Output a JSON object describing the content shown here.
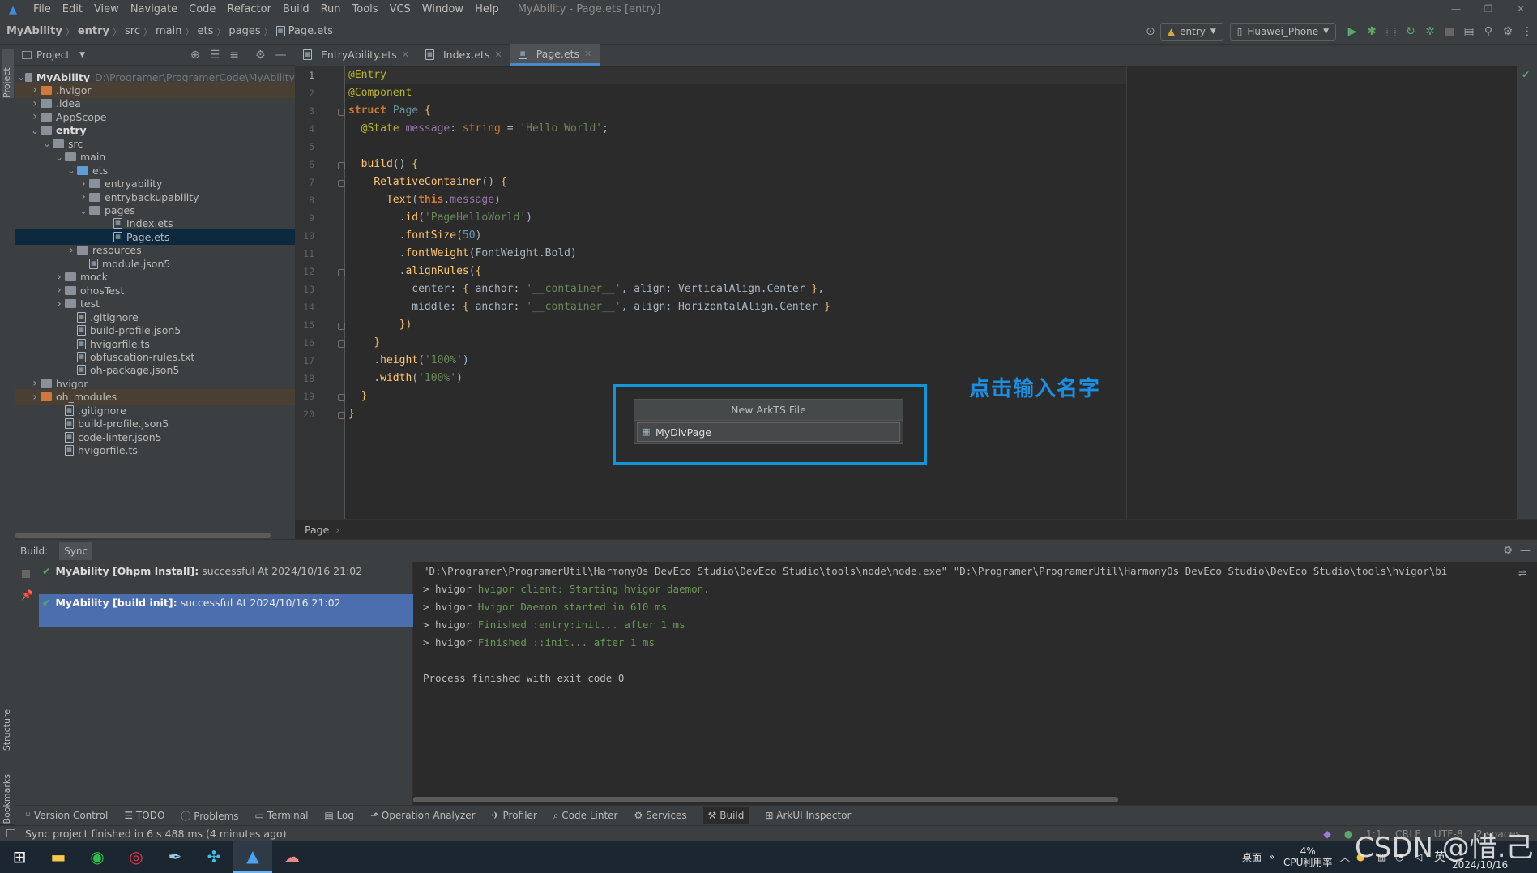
{
  "window": {
    "title": "MyAbility - Page.ets [entry]"
  },
  "menu": [
    "File",
    "Edit",
    "View",
    "Navigate",
    "Code",
    "Refactor",
    "Build",
    "Run",
    "Tools",
    "VCS",
    "Window",
    "Help"
  ],
  "breadcrumb": [
    "MyAbility",
    "entry",
    "src",
    "main",
    "ets",
    "pages",
    "Page.ets"
  ],
  "toolbar": {
    "module_selector": "entry",
    "device_selector": "Huawei_Phone"
  },
  "project_panel": {
    "title": "Project",
    "tree": [
      {
        "label": "MyAbility",
        "path": "D:\\Programer\\ProgramerCode\\MyAbility",
        "depth": 0,
        "kind": "module",
        "open": true
      },
      {
        "label": ".hvigor",
        "depth": 1,
        "kind": "folder-orange",
        "open": false,
        "excluded": true
      },
      {
        "label": ".idea",
        "depth": 1,
        "kind": "folder",
        "open": false
      },
      {
        "label": "AppScope",
        "depth": 1,
        "kind": "folder",
        "open": false
      },
      {
        "label": "entry",
        "depth": 1,
        "kind": "module",
        "open": true
      },
      {
        "label": "src",
        "depth": 2,
        "kind": "folder",
        "open": true
      },
      {
        "label": "main",
        "depth": 3,
        "kind": "folder",
        "open": true
      },
      {
        "label": "ets",
        "depth": 4,
        "kind": "folder-blue",
        "open": true
      },
      {
        "label": "entryability",
        "depth": 5,
        "kind": "folder",
        "open": false
      },
      {
        "label": "entrybackupability",
        "depth": 5,
        "kind": "folder",
        "open": false
      },
      {
        "label": "pages",
        "depth": 5,
        "kind": "folder",
        "open": true
      },
      {
        "label": "Index.ets",
        "depth": 7,
        "kind": "file"
      },
      {
        "label": "Page.ets",
        "depth": 7,
        "kind": "file",
        "selected": true
      },
      {
        "label": "resources",
        "depth": 4,
        "kind": "folder",
        "open": false
      },
      {
        "label": "module.json5",
        "depth": 5,
        "kind": "file"
      },
      {
        "label": "mock",
        "depth": 3,
        "kind": "folder",
        "open": false
      },
      {
        "label": "ohosTest",
        "depth": 3,
        "kind": "folder",
        "open": false
      },
      {
        "label": "test",
        "depth": 3,
        "kind": "folder",
        "open": false
      },
      {
        "label": ".gitignore",
        "depth": 4,
        "kind": "file"
      },
      {
        "label": "build-profile.json5",
        "depth": 4,
        "kind": "file"
      },
      {
        "label": "hvigorfile.ts",
        "depth": 4,
        "kind": "file"
      },
      {
        "label": "obfuscation-rules.txt",
        "depth": 4,
        "kind": "file"
      },
      {
        "label": "oh-package.json5",
        "depth": 4,
        "kind": "file"
      },
      {
        "label": "hvigor",
        "depth": 1,
        "kind": "folder",
        "open": false
      },
      {
        "label": "oh_modules",
        "depth": 1,
        "kind": "folder-orange",
        "open": false,
        "excluded": true
      },
      {
        "label": ".gitignore",
        "depth": 3,
        "kind": "file"
      },
      {
        "label": "build-profile.json5",
        "depth": 3,
        "kind": "file"
      },
      {
        "label": "code-linter.json5",
        "depth": 3,
        "kind": "file"
      },
      {
        "label": "hvigorfile.ts",
        "depth": 3,
        "kind": "file"
      }
    ]
  },
  "editor": {
    "tabs": [
      {
        "label": "EntryAbility.ets",
        "active": false
      },
      {
        "label": "Index.ets",
        "active": false
      },
      {
        "label": "Page.ets",
        "active": true
      }
    ],
    "line_numbers": [
      "1",
      "2",
      "3",
      "4",
      "5",
      "6",
      "7",
      "8",
      "9",
      "10",
      "11",
      "12",
      "13",
      "14",
      "15",
      "16",
      "17",
      "18",
      "19",
      "20"
    ],
    "breadcrumb": "Page"
  },
  "dialog": {
    "title": "New ArkTS File",
    "input_value": "MyDivPage"
  },
  "annotation": "点击输入名字",
  "build_panel": {
    "label": "Build:",
    "tab": "Sync",
    "entries": [
      {
        "title": "MyAbility [Ohpm Install]:",
        "status": "successful At 2024/10/16 21:02"
      },
      {
        "title": "MyAbility [build init]:",
        "status": "successful At 2024/10/16 21:02"
      }
    ],
    "console": {
      "cmd": "\"D:\\Programer\\ProgramerUtil\\HarmonyOs DevEco Studio\\DevEco Studio\\tools\\node\\node.exe\" \"D:\\Programer\\ProgramerUtil\\HarmonyOs DevEco Studio\\DevEco Studio\\tools\\hvigor\\bi",
      "lines": [
        {
          "prefix": "> hvigor ",
          "text": "hvigor client: Starting hvigor daemon."
        },
        {
          "prefix": "> hvigor ",
          "text": "Hvigor Daemon started in 610 ms"
        },
        {
          "prefix": "> hvigor ",
          "text": "Finished :entry:init... after 1 ms"
        },
        {
          "prefix": "> hvigor ",
          "text": "Finished ::init... after 1 ms"
        }
      ],
      "exit": "Process finished with exit code 0"
    }
  },
  "tool_windows": [
    "Version Control",
    "TODO",
    "Problems",
    "Terminal",
    "Log",
    "Operation Analyzer",
    "Profiler",
    "Code Linter",
    "Services",
    "Build",
    "ArkUI Inspector"
  ],
  "status": {
    "message": "Sync project finished in 6 s 488 ms (4 minutes ago)",
    "position": "1:1",
    "line_sep": "CRLF",
    "encoding": "UTF-8",
    "indent": "2 spaces"
  },
  "side_labels": {
    "project": "Project",
    "structure": "Structure",
    "bookmarks": "Bookmarks"
  },
  "taskbar": {
    "desktop": "桌面",
    "cpu_percent": "4%",
    "cpu_label": "CPU利用率",
    "ime": "英",
    "date": "2024/10/16",
    "watermark": "CSDN @惜.己"
  }
}
